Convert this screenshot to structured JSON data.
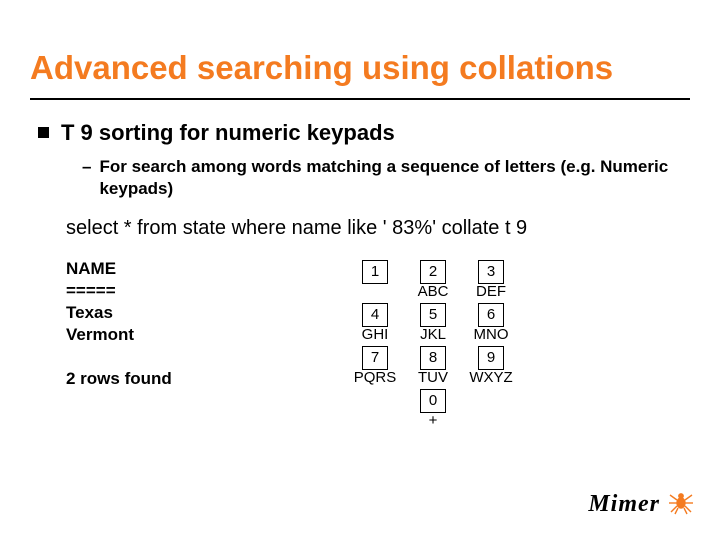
{
  "title": "Advanced searching using collations",
  "bullet1": "T 9 sorting for numeric keypads",
  "bullet2": "For search among words matching a sequence of letters (e.g. Numeric keypads)",
  "sql": "select * from state where name like ' 83%' collate t 9",
  "result": {
    "header": "NAME",
    "divider": "=====",
    "row1": "Texas",
    "row2": "Vermont",
    "footer": "2 rows found"
  },
  "keypad": {
    "k1": "1",
    "l1": "",
    "k2": "2",
    "l2": "ABC",
    "k3": "3",
    "l3": "DEF",
    "k4": "4",
    "l4": "GHI",
    "k5": "5",
    "l5": "JKL",
    "k6": "6",
    "l6": "MNO",
    "k7": "7",
    "l7": "PQRS",
    "k8": "8",
    "l8": "TUV",
    "k9": "9",
    "l9": "WXYZ",
    "k0": "0",
    "l0": "+"
  },
  "logo": "Mimer"
}
